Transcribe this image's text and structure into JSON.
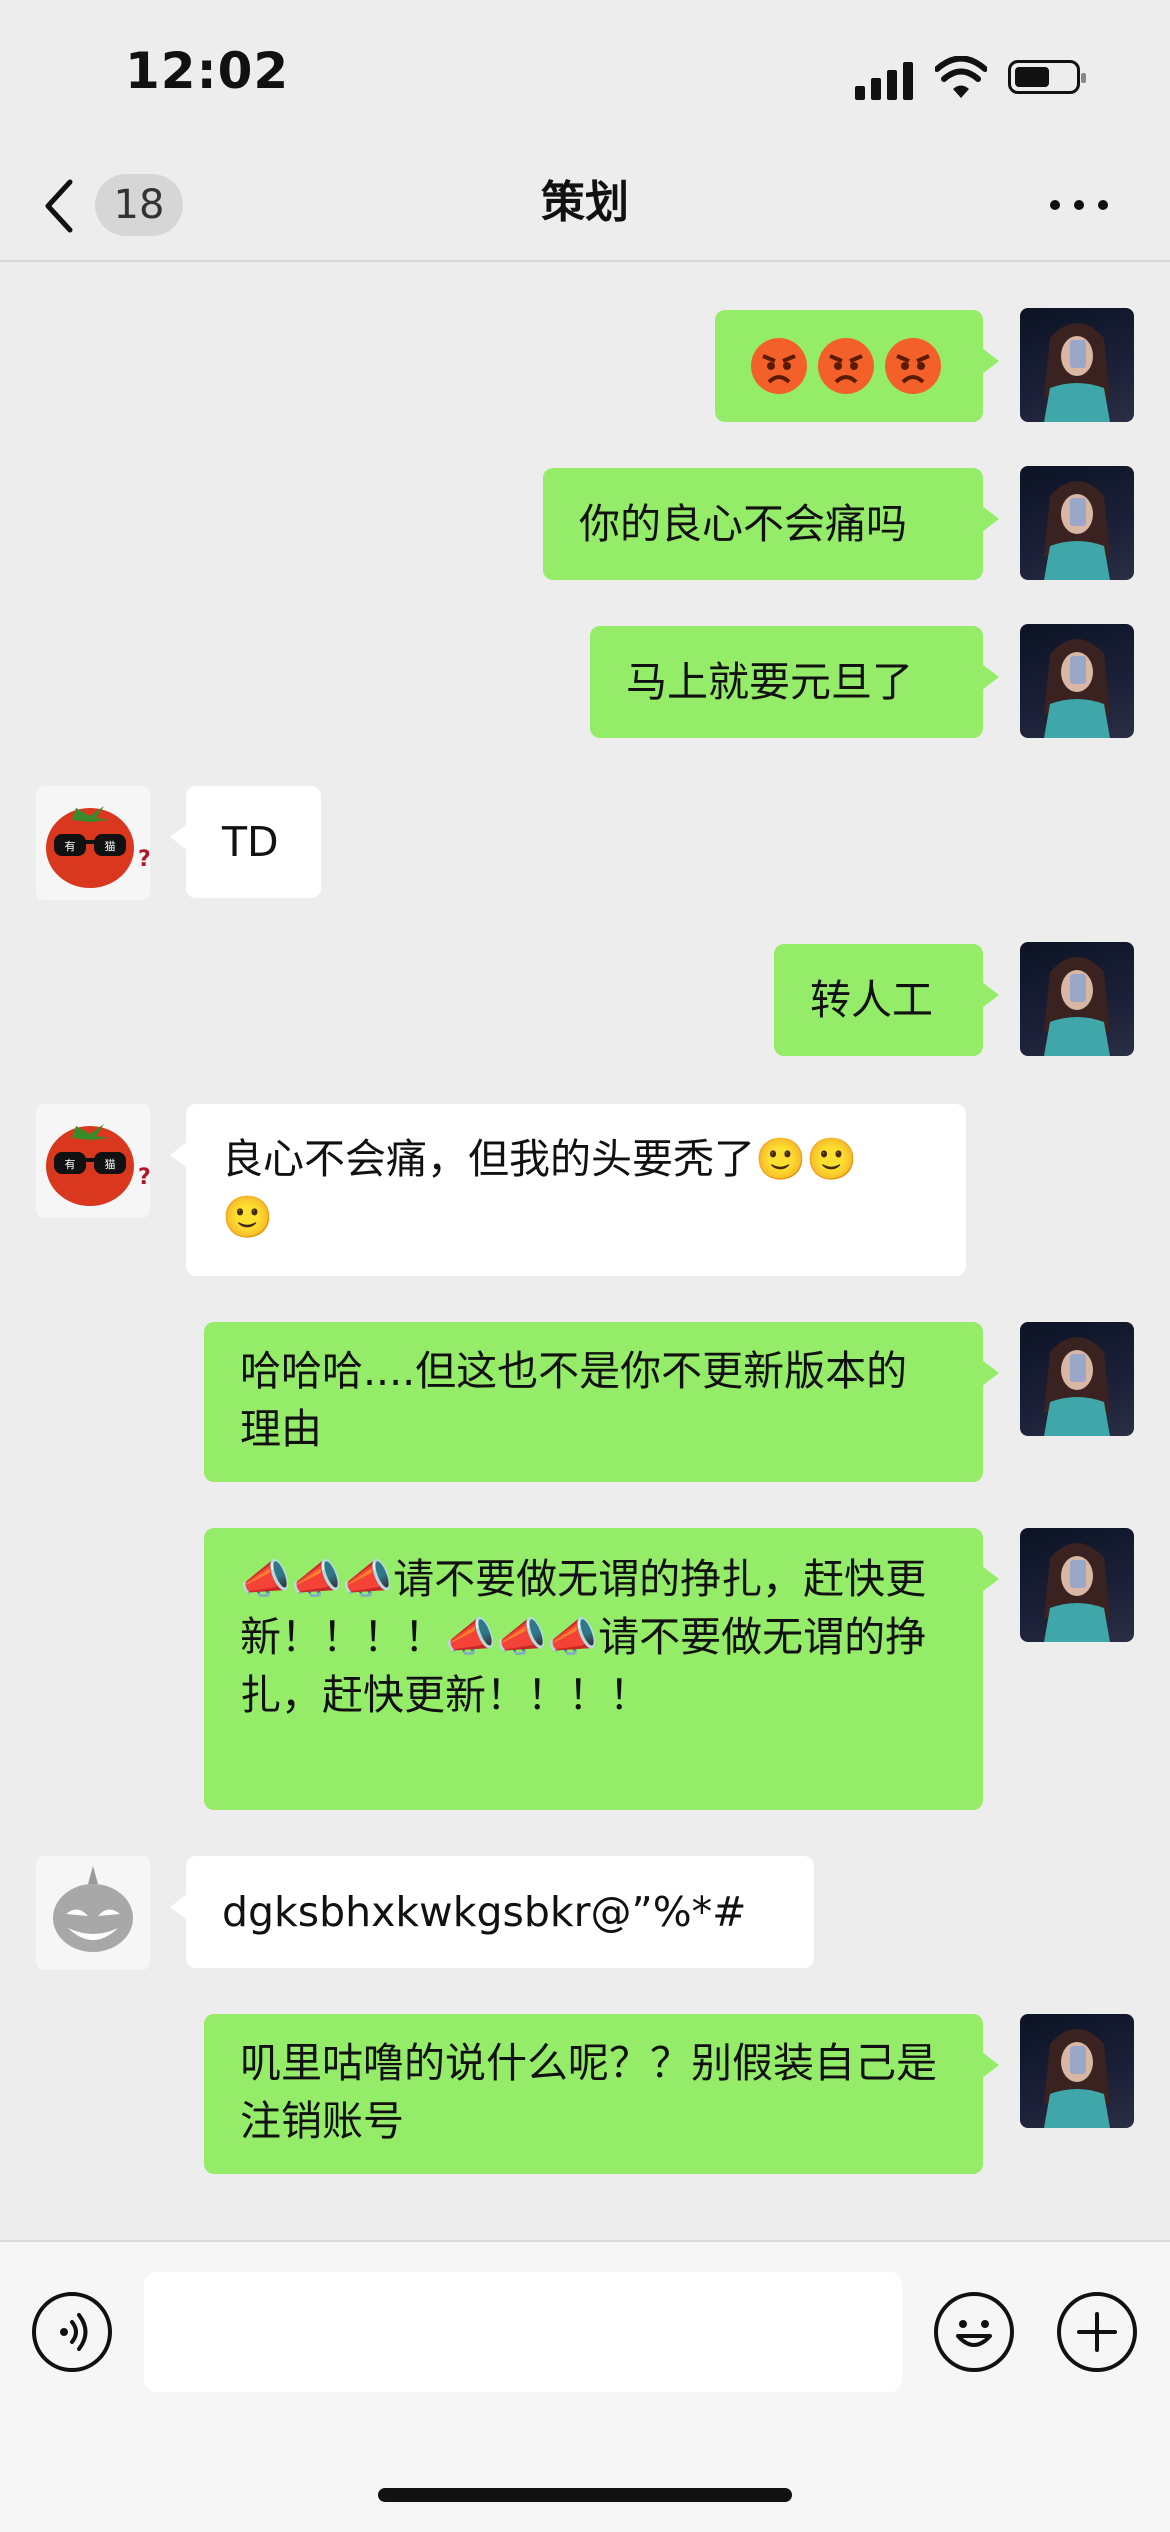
{
  "status_bar": {
    "time": "12:02"
  },
  "nav": {
    "unread_count": "18",
    "title": "策划"
  },
  "messages": [
    {
      "side": "mine",
      "text": "😡😡😡"
    },
    {
      "side": "mine",
      "text": "你的良心不会痛吗"
    },
    {
      "side": "mine",
      "text": "马上就要元旦了"
    },
    {
      "side": "theirs",
      "text": "TD"
    },
    {
      "side": "mine",
      "text": "转人工"
    },
    {
      "side": "theirs",
      "text": "良心不会痛，但我的头要秃了🙂🙂🙂"
    },
    {
      "side": "mine",
      "text": "哈哈哈....但这也不是你不更新版本的理由"
    },
    {
      "side": "mine",
      "text": "📣📣📣请不要做无谓的挣扎，赶快更新！！！！📣📣📣请不要做无谓的挣扎，赶快更新！！！！"
    },
    {
      "side": "theirs",
      "text": "dgksbhxkwkgsbkr@”%*#"
    },
    {
      "side": "mine",
      "text": "叽里咕噜的说什么呢？？别假装自己是注销账号"
    }
  ],
  "avatar_badge_text": "有 猫",
  "icons": {
    "back": "chevron-left-icon",
    "more": "more-icon",
    "voice": "voice-icon",
    "emoji": "emoji-icon",
    "add": "plus-icon"
  },
  "colors": {
    "mine_bubble": "#95ec69",
    "theirs_bubble": "#ffffff",
    "background": "#ededed"
  }
}
